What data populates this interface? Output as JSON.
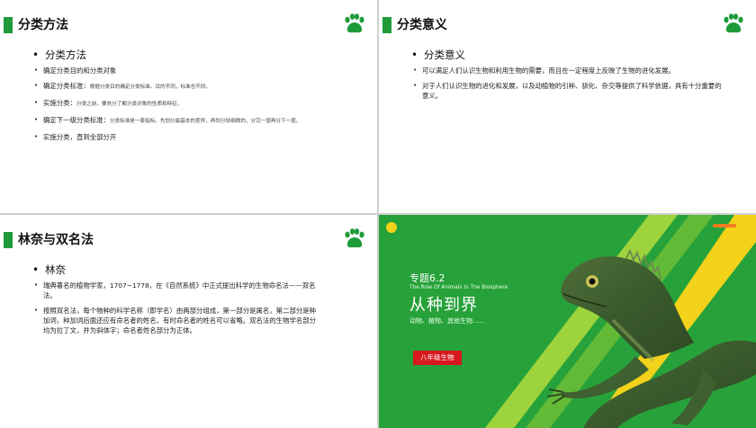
{
  "colors": {
    "accent_green": "#1f9b3a",
    "cover_green": "#27a23a",
    "tag_red": "#d8181e",
    "stripe_yellow": "#f2d21a"
  },
  "icons": {
    "paw": "paw-icon"
  },
  "slide1": {
    "title": "分类方法",
    "heading": "分类方法",
    "items": [
      {
        "main": "确定分类目的和分类对象",
        "detail": ""
      },
      {
        "main": "确定分类标准：",
        "detail": "根据分类目的确定分类标准。目的不同，标准也不同。"
      },
      {
        "main": "实施分类：",
        "detail": "分类之前，要充分了解分类对象的性质和特征。"
      },
      {
        "main": "确定下一级分类标准：",
        "detail": "分类标准是一套指标。先划分最基本的差异，再划分较细微的，分完一层再分下一层。"
      },
      {
        "main": "实施分类，直到全部分开",
        "detail": ""
      }
    ]
  },
  "slide2": {
    "title": "分类意义",
    "heading": "分类意义",
    "items": [
      "可以满足人们认识生物和利用生物的需要，而且在一定程度上反映了生物的进化发展。",
      "对于人们认识生物的进化和发展，以及动植物的引种、驯化、杂交等提供了科学依据，具有十分重要的意义。"
    ]
  },
  "slide3": {
    "title": "林奈与双名法",
    "heading": "林奈",
    "items": [
      "瑞典著名的植物学家，1707~1778，在《自然系统》中正式提出科学的生物命名法——双名法。",
      "按照双名法，每个物种的科学名称（即学名）由两部分组成，第一部分是属名，第二部分是种加词，种加词后面还应有命名者的姓名，有时命名者的姓名可以省略。双名法的生物学名部分均为拉丁文，并为斜体字；命名者姓名部分为正体。"
    ]
  },
  "cover": {
    "topic": "专题6.2",
    "english": "The Role Of Animals In The Biosphere",
    "title": "从种到界",
    "subtitle": "动物、植物、其他生物……",
    "tag": "八年级生物"
  }
}
